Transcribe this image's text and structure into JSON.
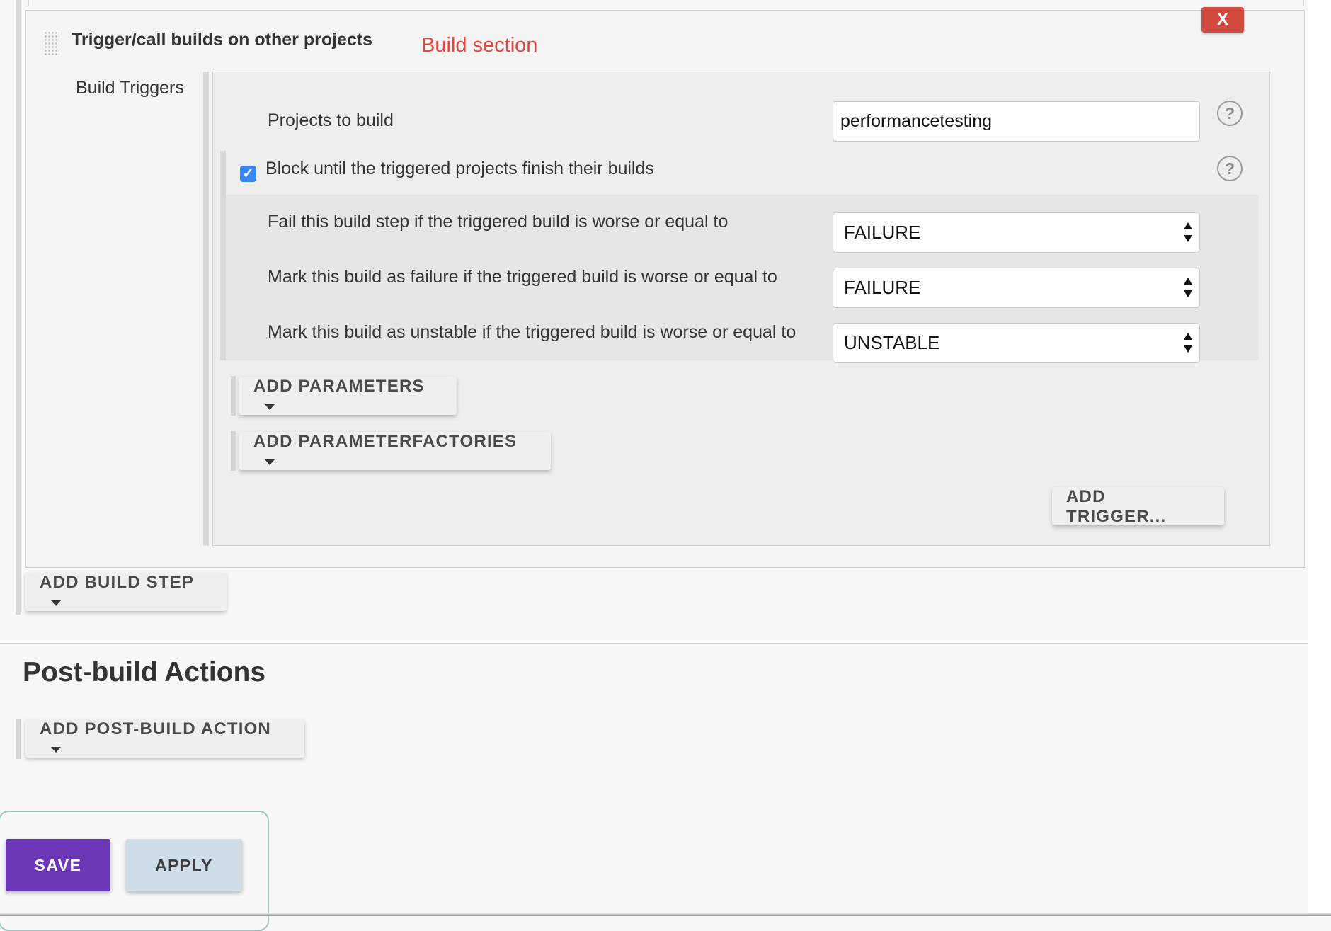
{
  "build_step": {
    "title": "Trigger/call builds on other projects",
    "annotation": "Build section",
    "close_label": "X",
    "field_label": "Build Triggers",
    "trigger": {
      "projects_label": "Projects to build",
      "projects_value": "performancetesting",
      "block_checked": true,
      "block_label": "Block until the triggered projects finish their builds",
      "fail_label": "Fail this build step if the triggered build is worse or equal to",
      "fail_value": "FAILURE",
      "failure_label": "Mark this build as failure if the triggered build is worse or equal to",
      "failure_value": "FAILURE",
      "unstable_label": "Mark this build as unstable if the triggered build is worse or equal to",
      "unstable_value": "UNSTABLE",
      "help_glyph": "?"
    },
    "add_parameters": "ADD PARAMETERS",
    "add_parameterfactories": "ADD PARAMETERFACTORIES",
    "add_trigger": "ADD TRIGGER..."
  },
  "add_build_step": "ADD BUILD STEP",
  "post_build": {
    "heading": "Post-build Actions",
    "add_action": "ADD POST-BUILD ACTION"
  },
  "footer": {
    "save": "SAVE",
    "apply": "APPLY"
  },
  "icons": {
    "drag_handle": "drag-handle-icon",
    "help": "help-icon",
    "caret": "caret-down-icon",
    "checkbox": "checkmark-icon",
    "select_arrows": "select-arrows-icon"
  },
  "colors": {
    "annotation": "#e8443c",
    "close_button": "#d24a3f",
    "checkbox": "#3a86f0",
    "save_button": "#6a37b5",
    "apply_button": "#cfdde9"
  }
}
